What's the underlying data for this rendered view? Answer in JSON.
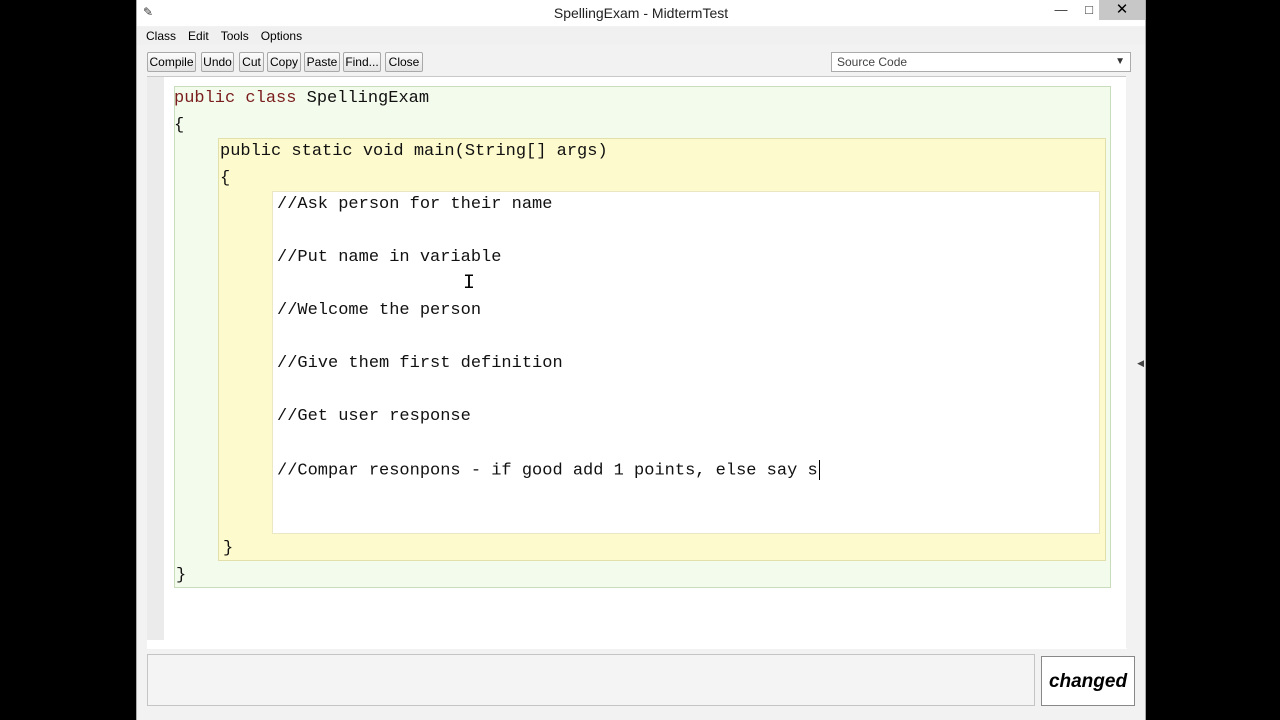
{
  "window": {
    "title": "SpellingExam - MidtermTest"
  },
  "menu": [
    "Class",
    "Edit",
    "Tools",
    "Options"
  ],
  "toolbar": {
    "buttons": [
      "Compile",
      "Undo",
      "Cut",
      "Copy",
      "Paste",
      "Find...",
      "Close"
    ],
    "view_select": "Source Code"
  },
  "code": {
    "class_kw1": "public",
    "class_kw2": "class",
    "class_name": "SpellingExam",
    "open_brace": "{",
    "close_brace": "}",
    "method_sig": "public static void main(String[] args)",
    "method_open": "{",
    "method_close": "}",
    "comments": [
      "//Ask person for their name",
      "//Put name in variable",
      "//Welcome the person",
      "//Give them first definition",
      "//Get user response",
      "//Compar resonpons - if good add 1 points, else say s"
    ]
  },
  "status": {
    "badge": "changed"
  },
  "colors": {
    "keyword": "#7a1d1d",
    "class_bg": "#f3fbec",
    "method_bg": "#fdfacd",
    "body_bg": "#ffffff"
  }
}
